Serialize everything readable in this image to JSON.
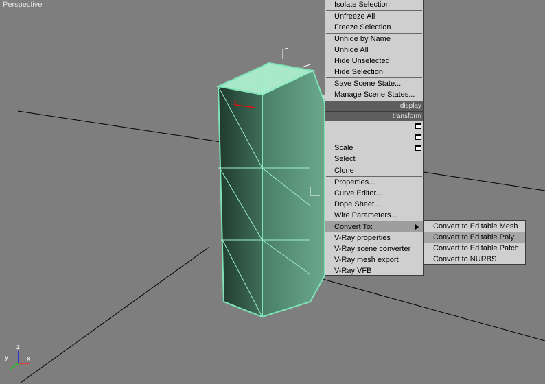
{
  "viewport": {
    "label": "Perspective",
    "axis_labels": {
      "x": "x",
      "y": "y",
      "z": "z"
    },
    "colors": {
      "background": "#7e7e7e",
      "selection": "#7de3b6",
      "gizmo_x": "#e01010"
    }
  },
  "quad_menu": {
    "display_header": "display",
    "transform_header": "transform",
    "display_items": {
      "isolate": "Isolate Selection",
      "unfreeze_all": "Unfreeze All",
      "freeze_selection": "Freeze Selection",
      "unhide_by_name": "Unhide by Name",
      "unhide_all": "Unhide All",
      "hide_unselected": "Hide Unselected",
      "hide_selection": "Hide Selection",
      "save_scene_state": "Save Scene State...",
      "manage_scene_states": "Manage Scene States..."
    },
    "transform_items": {
      "move": "",
      "rotate": "",
      "scale": "Scale",
      "select": "Select",
      "clone": "Clone",
      "properties": "Properties...",
      "curve_editor": "Curve Editor...",
      "dope_sheet": "Dope Sheet...",
      "wire_parameters": "Wire Parameters...",
      "convert_to": "Convert To:",
      "vray_properties": "V-Ray properties",
      "vray_scene_converter": "V-Ray scene converter",
      "vray_mesh_export": "V-Ray mesh export",
      "vray_vfb": "V-Ray VFB"
    },
    "highlighted_item": "Convert To:"
  },
  "convert_submenu": {
    "items": {
      "editable_mesh": "Convert to Editable Mesh",
      "editable_poly": "Convert to Editable Poly",
      "editable_patch": "Convert to Editable Patch",
      "nurbs": "Convert to NURBS"
    },
    "highlighted_item": "Convert to Editable Poly"
  }
}
